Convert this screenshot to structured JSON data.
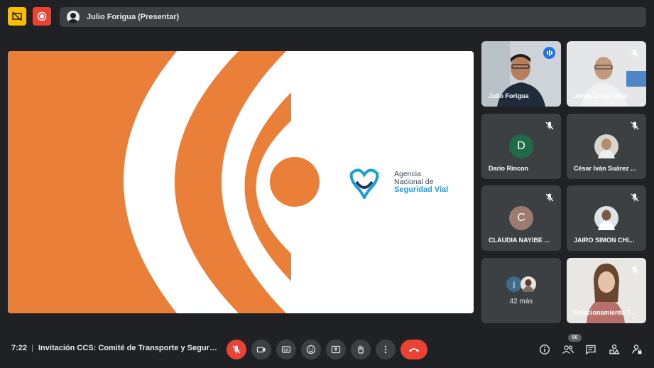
{
  "top_bar": {
    "presenter_label": "Julio Forigua (Presentar)"
  },
  "presentation": {
    "logo_line1": "Agencia",
    "logo_line2": "Nacional de",
    "logo_line3": "Seguridad Vial",
    "accent_color": "#e97f38",
    "brand_blue": "#1a9fd9"
  },
  "participants": [
    {
      "name": "Julio Forigua",
      "state": "speaking"
    },
    {
      "name": "Jorge Johan Olav...",
      "state": "muted"
    },
    {
      "name": "Dario Rincon",
      "initial": "D",
      "avatar_color": "#1e6b45",
      "state": "muted"
    },
    {
      "name": "César Iván Suárez ...",
      "state": "muted"
    },
    {
      "name": "CLAUDIA NAYIBE ...",
      "initial": "C",
      "avatar_color": "#9c7b70",
      "state": "muted"
    },
    {
      "name": "JAIRO SIMON CHI...",
      "state": "muted"
    },
    {
      "name": "Relacionamiento T...",
      "state": "muted"
    }
  ],
  "more_tile": {
    "initial": "j",
    "label": "42 más"
  },
  "bottom_bar": {
    "time": "7:22",
    "separator": "|",
    "meeting_title": "Invitación CCS: Comité de Transporte y Seguridad Vial",
    "participant_count": "50"
  },
  "icons": {
    "presenting": "presentation-off-icon",
    "recording": "record-icon",
    "mic": "mic-off-icon",
    "camera": "camera-icon",
    "captions": "captions-icon",
    "reactions": "emoji-icon",
    "present": "present-screen-icon",
    "raise_hand": "hand-icon",
    "more": "more-vert-icon",
    "hangup": "call-end-icon",
    "info": "info-icon",
    "people": "people-icon",
    "chat": "chat-icon",
    "activities": "activities-icon",
    "host_controls": "lock-person-icon"
  }
}
